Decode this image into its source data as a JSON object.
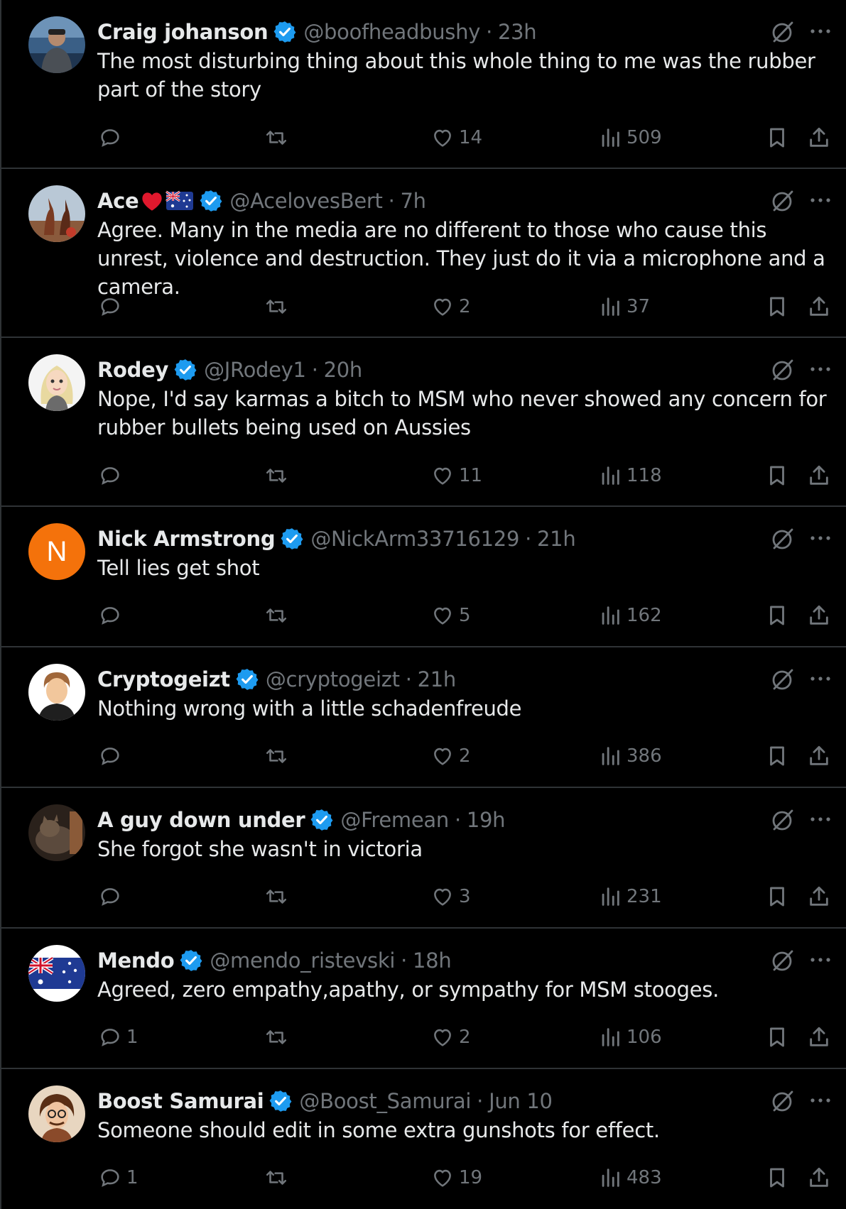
{
  "tweets": [
    {
      "name": "Craig johanson",
      "handle": "@boofheadbushy",
      "separator": "·",
      "time": "23h",
      "text": "The most disturbing thing about this whole thing to me was the rubber part of the story",
      "replies": "",
      "retweets": "",
      "likes": "14",
      "views": "509",
      "avatar": "photo-person-outdoors"
    },
    {
      "name": "Ace",
      "name_emoji": [
        "red-heart",
        "australian-flag"
      ],
      "handle": "@AcelovesBert",
      "separator": "·",
      "time": "7h",
      "text": "Agree. Many in the media are no different to those who cause this unrest, violence and destruction. They just do it via a microphone and a camera.",
      "replies": "",
      "retweets": "",
      "likes": "2",
      "views": "37",
      "avatar": "photo-kangaroo-statues"
    },
    {
      "name": "Rodey",
      "handle": "@JRodey1",
      "separator": "·",
      "time": "20h",
      "text": "Nope, I'd say karmas a bitch to MSM who never showed any concern for rubber bullets being used on Aussies",
      "replies": "",
      "retweets": "",
      "likes": "11",
      "views": "118",
      "avatar": "cartoon-blonde-woman"
    },
    {
      "name": "Nick Armstrong",
      "handle": "@NickArm33716129",
      "separator": "·",
      "time": "21h",
      "text": "Tell lies get shot",
      "replies": "",
      "retweets": "",
      "likes": "5",
      "views": "162",
      "avatar_letter": "N"
    },
    {
      "name": "Cryptogeizt",
      "handle": "@cryptogeizt",
      "separator": "·",
      "time": "21h",
      "text": "Nothing wrong with a little schadenfreude",
      "replies": "",
      "retweets": "",
      "likes": "2",
      "views": "386",
      "avatar": "default-person-silhouette"
    },
    {
      "name": "A guy down under",
      "handle": "@Fremean",
      "separator": "·",
      "time": "19h",
      "text": "She forgot she wasn't in victoria",
      "replies": "",
      "retweets": "",
      "likes": "3",
      "views": "231",
      "avatar": "photo-cat"
    },
    {
      "name": "Mendo",
      "handle": "@mendo_ristevski",
      "separator": "·",
      "time": "18h",
      "text": "Agreed, zero empathy,apathy, or sympathy for MSM stooges.",
      "replies": "1",
      "retweets": "",
      "likes": "2",
      "views": "106",
      "avatar": "australian-flag"
    },
    {
      "name": "Boost Samurai",
      "handle": "@Boost_Samurai",
      "separator": "·",
      "time": "Jun 10",
      "text": "Someone should edit in some extra gunshots for effect.",
      "replies": "1",
      "retweets": "",
      "likes": "19",
      "views": "483",
      "avatar": "cartoon-man-glasses"
    }
  ],
  "colors": {
    "background": "#000000",
    "divider": "#2f3336",
    "text": "#e7e9ea",
    "muted": "#71767b",
    "verified": "#1d9bf0",
    "avatar_orange": "#f4720b"
  },
  "icons": [
    "verified-badge-icon",
    "grok-icon",
    "more-icon",
    "reply-icon",
    "retweet-icon",
    "like-icon",
    "views-icon",
    "bookmark-icon",
    "share-icon"
  ]
}
